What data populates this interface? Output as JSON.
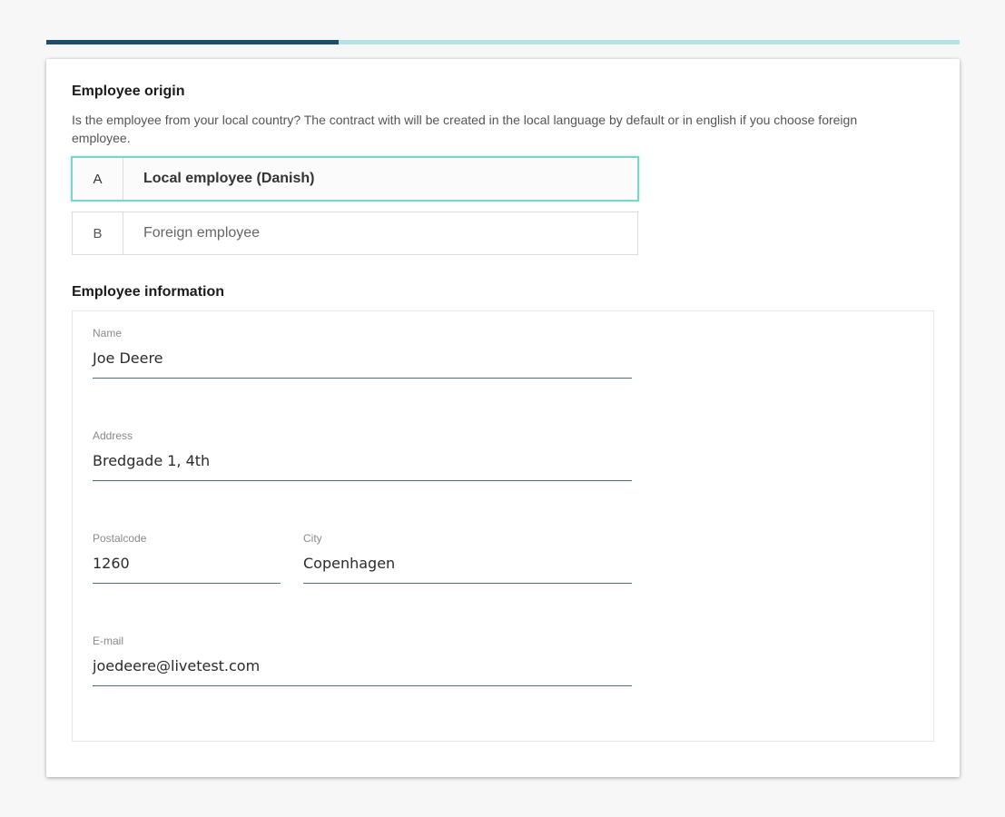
{
  "progress": {
    "fraction": 0.32
  },
  "origin": {
    "title": "Employee origin",
    "description": "Is the employee from your local country? The contract with will be created in the local language by default or in english if you choose foreign employee.",
    "options": [
      {
        "key": "A",
        "label": "Local employee (Danish)",
        "selected": true
      },
      {
        "key": "B",
        "label": "Foreign employee",
        "selected": false
      }
    ]
  },
  "info": {
    "title": "Employee information",
    "name": {
      "label": "Name",
      "value": "Joe Deere"
    },
    "address": {
      "label": "Address",
      "value": "Bredgade 1, 4th"
    },
    "postalcode": {
      "label": "Postalcode",
      "value": "1260"
    },
    "city": {
      "label": "City",
      "value": "Copenhagen"
    },
    "email": {
      "label": "E-mail",
      "value": "joedeere@livetest.com"
    }
  },
  "colors": {
    "progress_fill": "#1d4e6b",
    "progress_track": "#b4e3e4",
    "selected_border": "#7fd3c9"
  }
}
